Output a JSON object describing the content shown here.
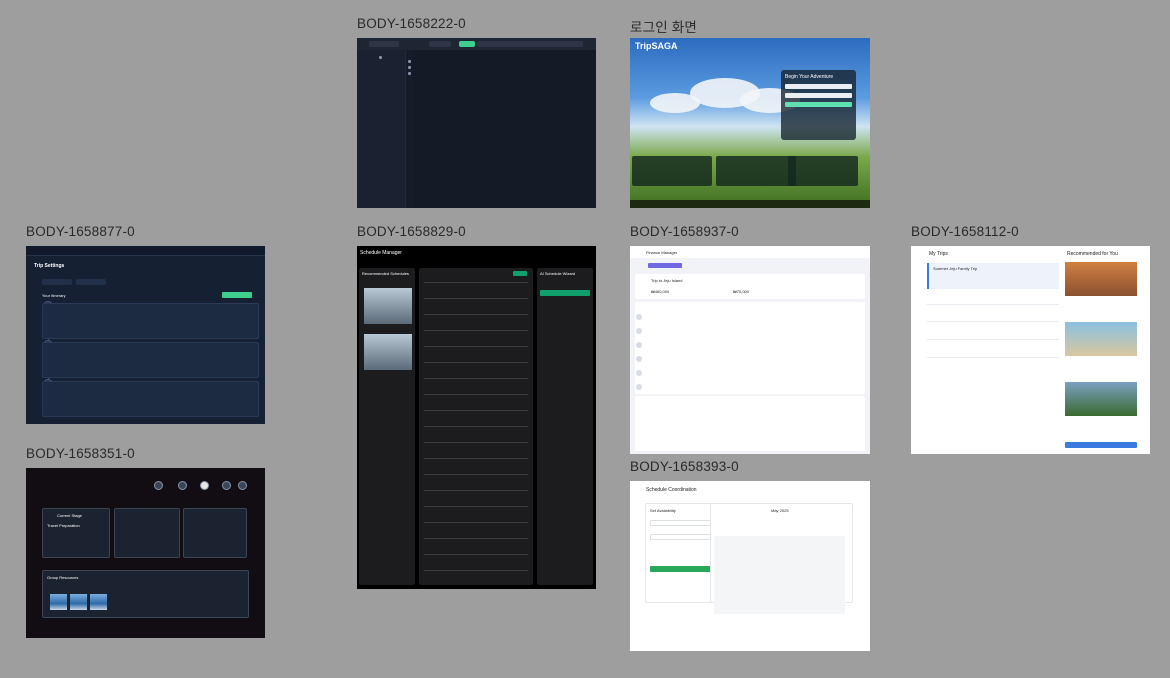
{
  "canvas": {
    "background": "#9e9e9e"
  },
  "frames": [
    {
      "id": "A",
      "label": "BODY-1658222-0"
    },
    {
      "id": "B",
      "label": "로그인 화면"
    },
    {
      "id": "C",
      "label": "BODY-1658877-0"
    },
    {
      "id": "D",
      "label": "BODY-1658351-0"
    },
    {
      "id": "E",
      "label": "BODY-1658829-0"
    },
    {
      "id": "F",
      "label": "BODY-1658937-0"
    },
    {
      "id": "G",
      "label": "BODY-1658112-0"
    },
    {
      "id": "H",
      "label": "BODY-1658393-0"
    }
  ],
  "content": {
    "login": {
      "brand": "TripSAGA",
      "heading": "Begin Your Adventure"
    },
    "trip_settings": {
      "title": "Trip Settings",
      "itinerary": "Your Itinerary"
    },
    "group": {
      "current_stage": "Current Stage",
      "prep": "Travel Preparation",
      "resources": "Group Resources"
    },
    "schedule_manager": {
      "title": "Schedule Manager",
      "recommended": "Recommended Schedules",
      "wizard": "AI Schedule Wizard"
    },
    "finance": {
      "title": "Finance Manager",
      "trip": "Trip to Jeju Island",
      "total": "₩460,000",
      "spent": "₩70,000"
    },
    "trips": {
      "title": "My Trips",
      "recommended": "Recommended for You",
      "upcoming": "Summer Jeju Family Trip"
    },
    "coordination": {
      "title": "Schedule Coordination",
      "month": "May 2025",
      "availability": "Set Availability"
    }
  }
}
